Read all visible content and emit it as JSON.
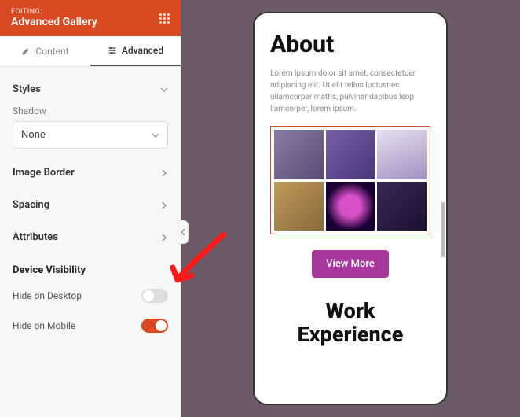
{
  "header": {
    "editing_label": "EDITING:",
    "title": "Advanced Gallery"
  },
  "tabs": {
    "content": "Content",
    "advanced": "Advanced"
  },
  "styles": {
    "title": "Styles",
    "shadow_label": "Shadow",
    "shadow_value": "None",
    "image_border": "Image Border",
    "spacing": "Spacing",
    "attributes": "Attributes"
  },
  "visibility": {
    "title": "Device Visibility",
    "hide_desktop": "Hide on Desktop",
    "hide_mobile": "Hide on Mobile",
    "hide_desktop_on": false,
    "hide_mobile_on": true
  },
  "preview": {
    "about_heading": "About",
    "lorem": "Lorem ipsum dolor sit amet, consectetuer adipiscing elit. Ut elit tellus luctusnec ullamcorper mattis, pulvinar dapibus leop llamcorper, lorem ipsum.",
    "button": "View More",
    "work_heading": "Work Experience"
  },
  "colors": {
    "accent": "#d94a23",
    "button": "#a8389b"
  }
}
